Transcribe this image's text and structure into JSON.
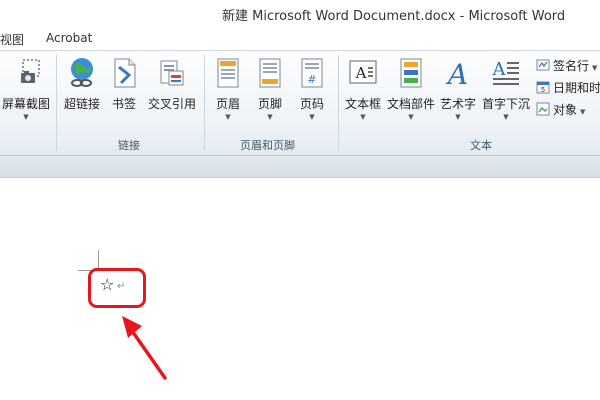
{
  "window": {
    "title": "新建 Microsoft Word Document.docx - Microsoft Word"
  },
  "menu": {
    "tabs": [
      "视图",
      "Acrobat"
    ]
  },
  "ribbon": {
    "screenshot_label": "屏幕截图",
    "links_group": {
      "label": "链接",
      "hyperlink": "超链接",
      "bookmark": "书签",
      "cross_ref": "交叉引用"
    },
    "header_footer_group": {
      "label": "页眉和页脚",
      "header": "页眉",
      "footer": "页脚",
      "page_number": "页码"
    },
    "text_group": {
      "label": "文本",
      "textbox": "文本框",
      "quick_parts": "文档部件",
      "wordart": "艺术字",
      "drop_cap": "首字下沉",
      "signature_line": "签名行",
      "date_time": "日期和时",
      "object": "对象"
    }
  },
  "document": {
    "star_char": "☆",
    "paragraph_mark": "↵"
  },
  "colors": {
    "highlight": "#e8161c",
    "ribbon_bg": "#eef3f8"
  }
}
